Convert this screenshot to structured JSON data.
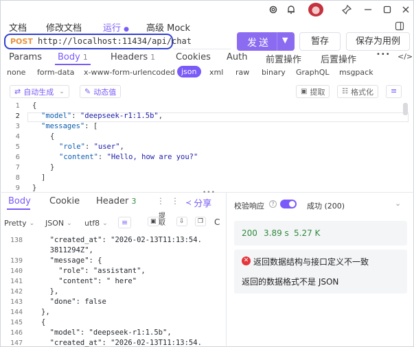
{
  "titlebar": {
    "icons": [
      "gear-icon",
      "bell-icon",
      "avatar",
      "pin-icon",
      "minimize-icon",
      "maximize-icon",
      "close-icon"
    ]
  },
  "top_tabs": [
    {
      "label": "文档"
    },
    {
      "label": "修改文档"
    },
    {
      "label": "运行"
    },
    {
      "label": "高级 Mock"
    }
  ],
  "request": {
    "method": "POST",
    "url": "http://localhost:11434/api/chat",
    "send_label": "发送",
    "save_label": "暂存",
    "save_as_case_label": "保存为用例"
  },
  "req_tabs": [
    {
      "label": "Params",
      "count": ""
    },
    {
      "label": "Body",
      "count": "1"
    },
    {
      "label": "Headers",
      "count": "1"
    },
    {
      "label": "Cookies",
      "count": ""
    },
    {
      "label": "Auth",
      "count": ""
    },
    {
      "label": "前置操作",
      "count": ""
    },
    {
      "label": "后置操作",
      "count": ""
    }
  ],
  "more_label": "•••",
  "code_toggle_label": "</>",
  "body_types": [
    "none",
    "form-data",
    "x-www-form-urlencoded",
    "json",
    "xml",
    "raw",
    "binary",
    "GraphQL",
    "msgpack"
  ],
  "toolbar": {
    "auto_generate": "自动生成",
    "dynamic_value": "动态值",
    "extract": "提取",
    "format": "格式化"
  },
  "request_body": {
    "line_numbers": [
      "1",
      "2",
      "3",
      "4",
      "5",
      "6",
      "7",
      "8",
      "9"
    ],
    "lines": [
      {
        "open": "{"
      },
      {
        "key": "\"model\"",
        "sep": ": ",
        "value": "\"deepseek-r1:1.5b\"",
        "tail": ","
      },
      {
        "key": "\"messages\"",
        "sep": ": ",
        "value": "",
        "tail": "["
      },
      {
        "open": "{"
      },
      {
        "key": "\"role\"",
        "sep": ": ",
        "value": "\"user\"",
        "tail": ","
      },
      {
        "key": "\"content\"",
        "sep": ": ",
        "value": "\"Hello, how are you?\"",
        "tail": ""
      },
      {
        "open": "}"
      },
      {
        "open": "]"
      },
      {
        "open": "}"
      }
    ]
  },
  "response_tabs": [
    {
      "label": "Body",
      "count": ""
    },
    {
      "label": "Cookie",
      "count": ""
    },
    {
      "label": "Header",
      "count": "3"
    }
  ],
  "share_label": "分享",
  "response_toolbar": {
    "view": "Pretty",
    "format": "JSON",
    "encoding": "utf8",
    "extract": "提取"
  },
  "response_body": {
    "lines": [
      {
        "num": "138",
        "text": "  \"created_at\": \"2026-02-13T11:13:54."
      },
      {
        "num": "",
        "text": "  3811294Z\","
      },
      {
        "num": "139",
        "text": "  \"message\": {"
      },
      {
        "num": "140",
        "text": "    \"role\": \"assistant\","
      },
      {
        "num": "141",
        "text": "    \"content\": \" here\""
      },
      {
        "num": "142",
        "text": "  },"
      },
      {
        "num": "143",
        "text": "  \"done\": false"
      },
      {
        "num": "144",
        "text": "},"
      },
      {
        "num": "145",
        "text": "{"
      },
      {
        "num": "146",
        "text": "  \"model\": \"deepseek-r1:1.5b\","
      },
      {
        "num": "147",
        "text": "  \"created_at\": \"2026-02-13T11:13:54."
      }
    ]
  },
  "validation": {
    "label": "校验响应",
    "status": "成功 (200)"
  },
  "stats": {
    "code": "200",
    "time": "3.89 s",
    "size": "5.27 K"
  },
  "error": {
    "title": "返回数据结构与接口定义不一致",
    "detail": "返回的数据格式不是 JSON"
  },
  "colors": {
    "accent": "#7a5af8",
    "method": "#e8913a",
    "success": "#2f8a3e",
    "error": "#e5343a"
  }
}
